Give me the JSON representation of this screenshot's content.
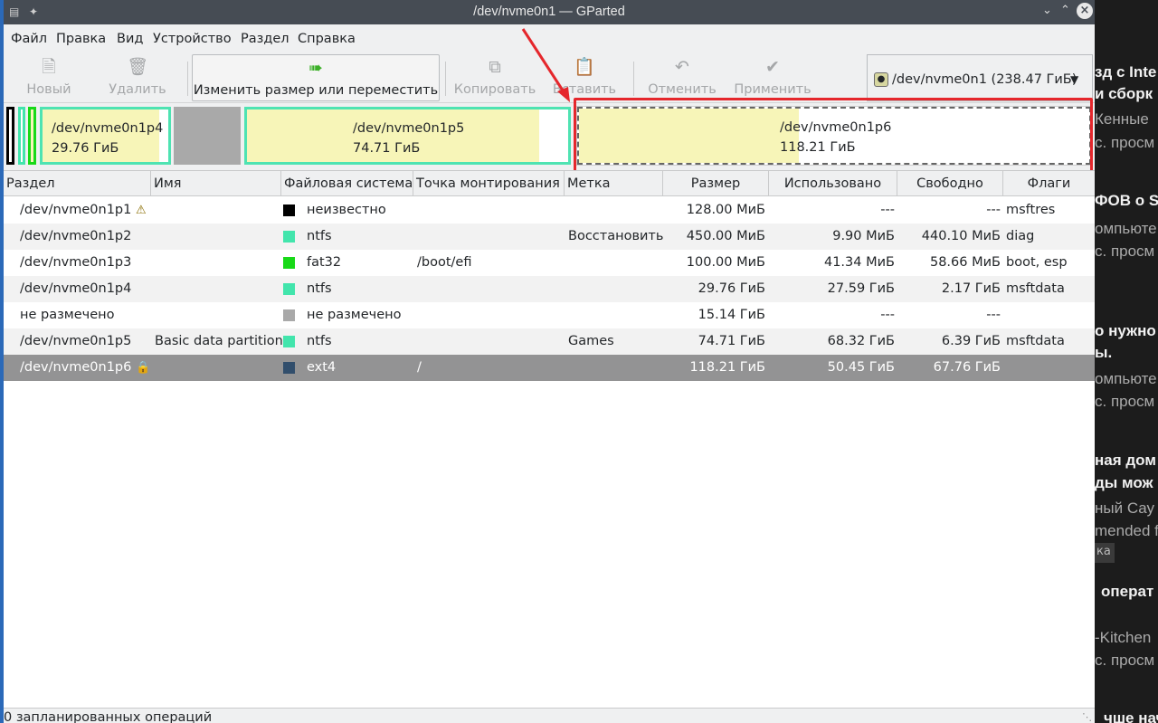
{
  "window": {
    "title": "/dev/nvme0n1 — GParted"
  },
  "menu": [
    "Файл",
    "Правка",
    "Вид",
    "Устройство",
    "Раздел",
    "Справка"
  ],
  "toolbar": {
    "new": "Новый",
    "delete": "Удалить",
    "resize": "Изменить размер или переместить",
    "copy": "Копировать",
    "paste": "Вставить",
    "undo": "Отменить",
    "apply": "Применить",
    "device": "/dev/nvme0n1  (238.47 ГиБ)"
  },
  "map": {
    "p4": {
      "name": "/dev/nvme0n1p4",
      "size": "29.76 ГиБ",
      "used_fraction": 0.93
    },
    "p5": {
      "name": "/dev/nvme0n1p5",
      "size": "74.71 ГиБ",
      "used_fraction": 0.91
    },
    "p6": {
      "name": "/dev/nvme0n1p6",
      "size": "118.21 ГиБ",
      "used_fraction": 0.43
    }
  },
  "table": {
    "columns": [
      "Раздел",
      "Имя",
      "Файловая система",
      "Точка монтирования",
      "Метка",
      "Размер",
      "Использовано",
      "Свободно",
      "Флаги"
    ],
    "rows": [
      {
        "partition": "/dev/nvme0n1p1",
        "icon": "warning-icon",
        "name": "",
        "fs": "неизвестно",
        "fs_color": "#000000",
        "mount": "",
        "label": "",
        "size": "128.00 МиБ",
        "used": "---",
        "free": "---",
        "flags": "msftres"
      },
      {
        "partition": "/dev/nvme0n1p2",
        "icon": "",
        "name": "",
        "fs": "ntfs",
        "fs_color": "#42e5ac",
        "mount": "",
        "label": "Восстановить",
        "size": "450.00 МиБ",
        "used": "9.90 МиБ",
        "free": "440.10 МиБ",
        "flags": "diag"
      },
      {
        "partition": "/dev/nvme0n1p3",
        "icon": "",
        "name": "",
        "fs": "fat32",
        "fs_color": "#18d918",
        "mount": "/boot/efi",
        "label": "",
        "size": "100.00 МиБ",
        "used": "41.34 МиБ",
        "free": "58.66 МиБ",
        "flags": "boot, esp"
      },
      {
        "partition": "/dev/nvme0n1p4",
        "icon": "",
        "name": "",
        "fs": "ntfs",
        "fs_color": "#42e5ac",
        "mount": "",
        "label": "",
        "size": "29.76 ГиБ",
        "used": "27.59 ГиБ",
        "free": "2.17 ГиБ",
        "flags": "msftdata"
      },
      {
        "partition": "не размечено",
        "icon": "",
        "name": "",
        "fs": "не размечено",
        "fs_color": "#a9a9a9",
        "mount": "",
        "label": "",
        "size": "15.14 ГиБ",
        "used": "---",
        "free": "---",
        "flags": ""
      },
      {
        "partition": "/dev/nvme0n1p5",
        "icon": "",
        "name": "Basic data partition",
        "fs": "ntfs",
        "fs_color": "#42e5ac",
        "mount": "",
        "label": "Games",
        "size": "74.71 ГиБ",
        "used": "68.32 ГиБ",
        "free": "6.39 ГиБ",
        "flags": "msftdata"
      },
      {
        "partition": "/dev/nvme0n1p6",
        "icon": "lock-icon",
        "name": "",
        "fs": "ext4",
        "fs_color": "#314e6c",
        "mount": "/",
        "label": "",
        "size": "118.21 ГиБ",
        "used": "50.45 ГиБ",
        "free": "67.76 ГиБ",
        "flags": ""
      }
    ]
  },
  "status": "0 запланированных операций",
  "background": {
    "lines": [
      "зд с Inte",
      "и сборк",
      "Кенные",
      "с. просм",
      "ФОВ о S",
      "омпьюте",
      "с. просм",
      "о нужно",
      "ы.",
      "омпьюте",
      "с. просм",
      "ная дом",
      "ды мож",
      "ный Сау",
      "mended f",
      "ка",
      "операт",
      "-Kitchen",
      "с. просм",
      "чше нач"
    ]
  }
}
